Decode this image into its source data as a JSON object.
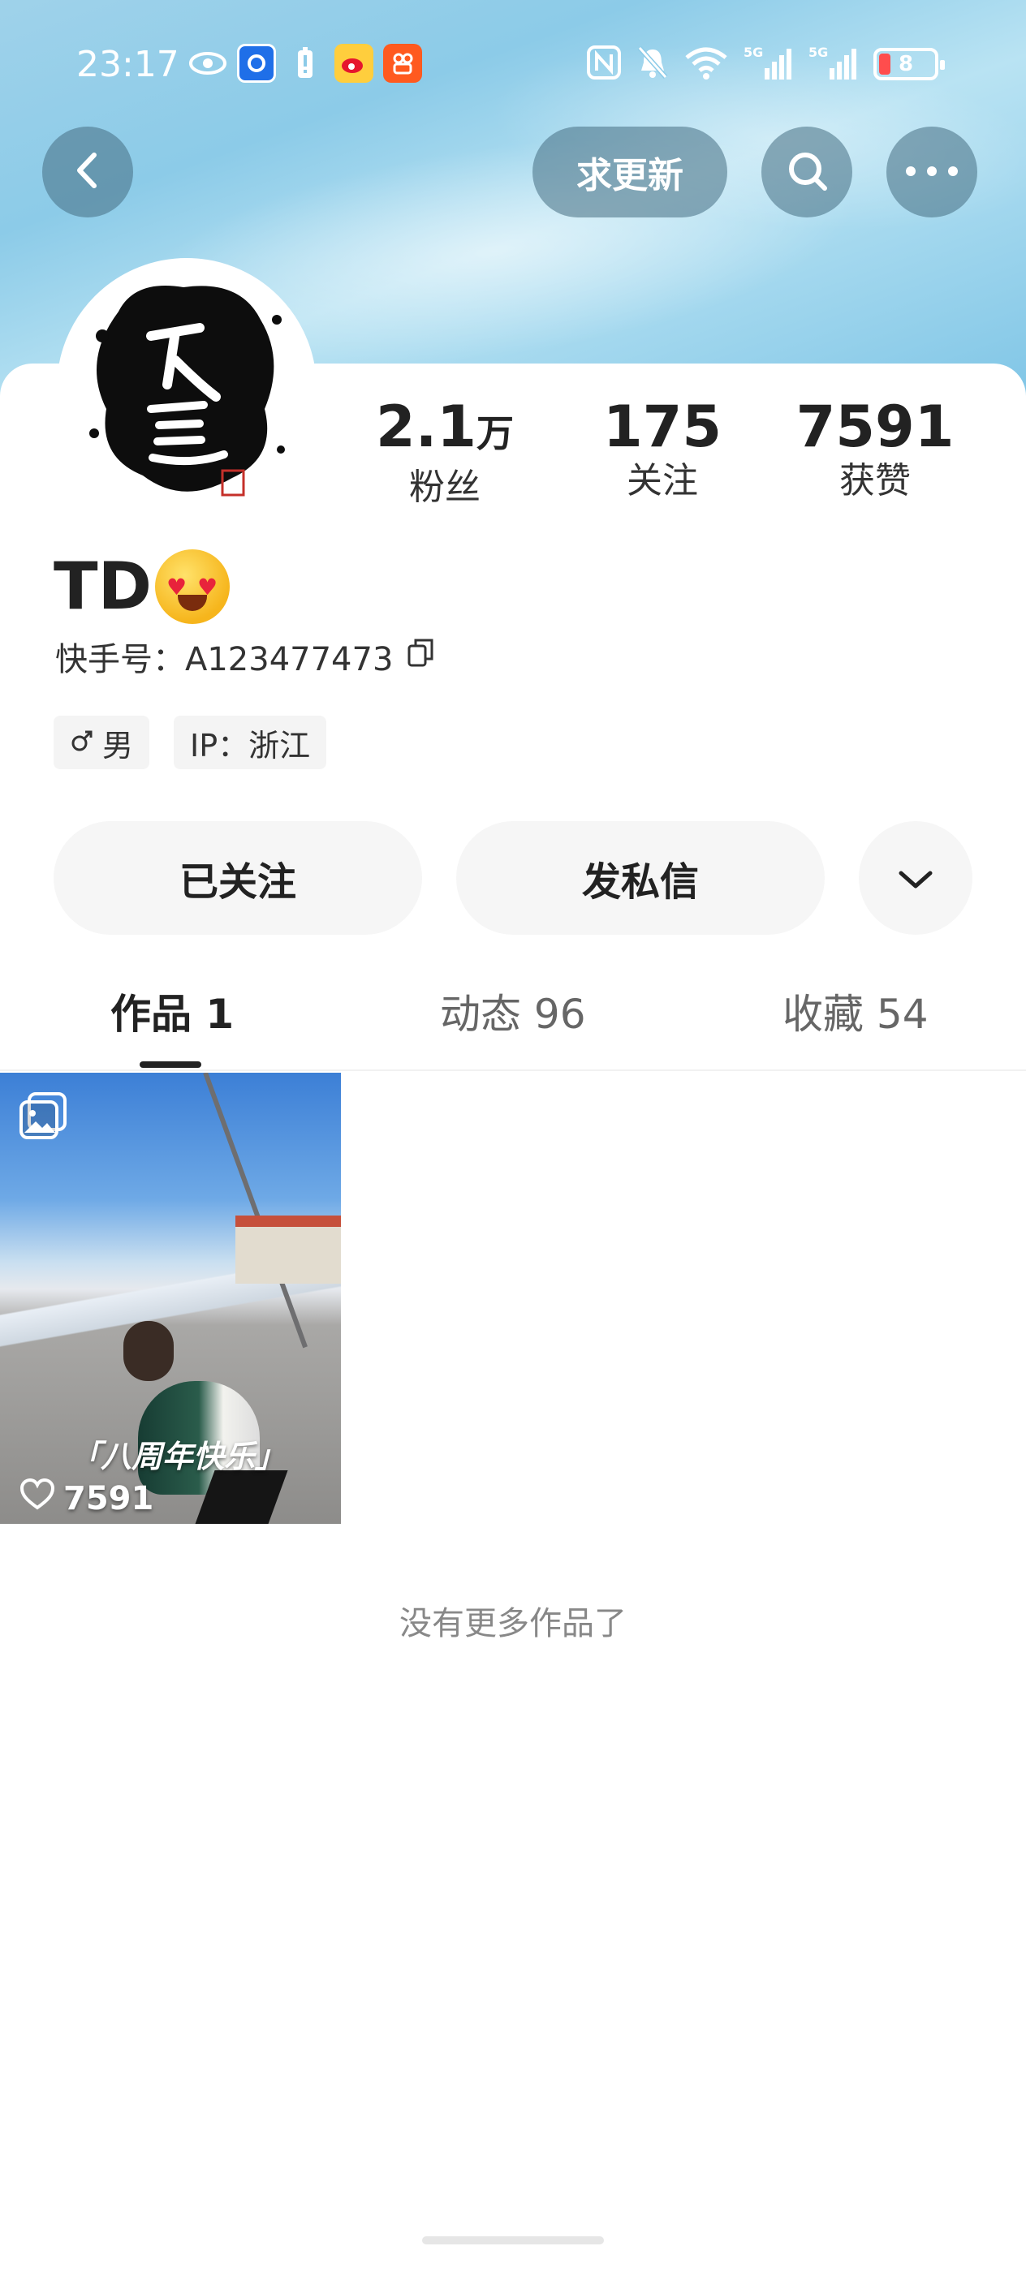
{
  "status_bar": {
    "time": "23:17",
    "battery": "8"
  },
  "nav": {
    "update_label": "求更新"
  },
  "profile": {
    "name": "TD",
    "kuaishou_id": "快手号：A123477473",
    "stats": [
      {
        "value": "2.1",
        "unit": "万",
        "label": "粉丝"
      },
      {
        "value": "175",
        "unit": "",
        "label": "关注"
      },
      {
        "value": "7591",
        "unit": "",
        "label": "获赞"
      }
    ],
    "tags": {
      "gender": "男",
      "ip": "IP：浙江"
    }
  },
  "actions": {
    "follow_label": "已关注",
    "message_label": "发私信"
  },
  "tabs": [
    {
      "label": "作品 1",
      "active": true
    },
    {
      "label": "动态 96",
      "active": false
    },
    {
      "label": "收藏 54",
      "active": false
    }
  ],
  "works": [
    {
      "caption": "「八周年快乐」",
      "likes": "7591"
    }
  ],
  "footer": {
    "no_more": "没有更多作品了"
  },
  "colors": {
    "header_sky": "#8ccbe8",
    "nav_button_bg": "#466e82",
    "button_bg": "#f6f6f6",
    "text_primary": "#222222",
    "text_secondary": "#888888"
  }
}
